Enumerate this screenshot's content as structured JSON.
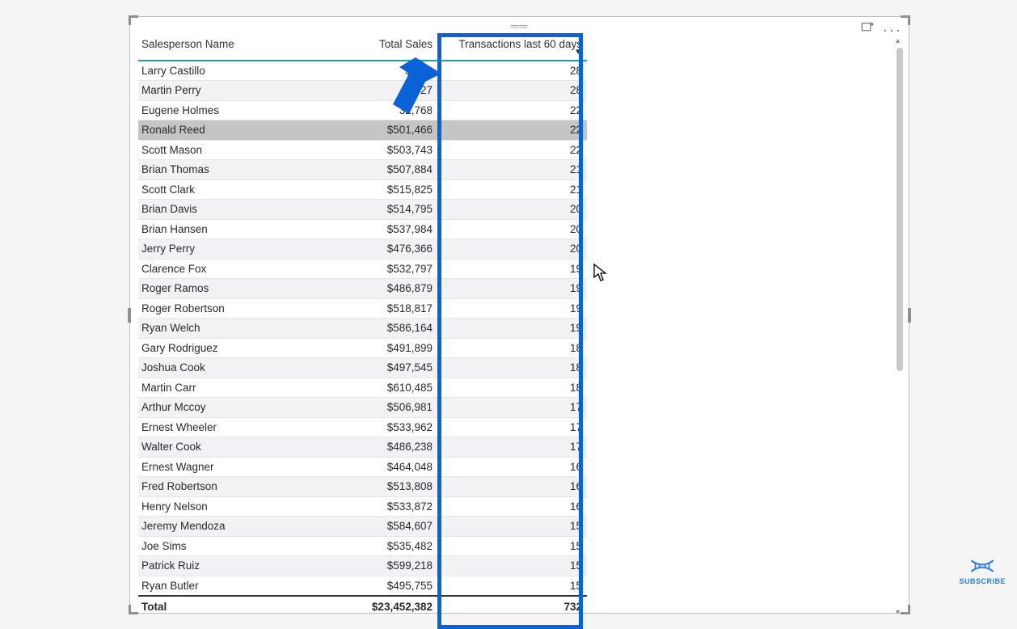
{
  "chart_data": {
    "type": "table",
    "columns": [
      "Salesperson Name",
      "Total Sales",
      "Transactions last 60 days"
    ],
    "rows": [
      [
        "Larry Castillo",
        "$483,   ",
        28
      ],
      [
        "Martin Perry",
        "$     27",
        28
      ],
      [
        "Eugene Holmes",
        "32,768",
        22
      ],
      [
        "Ronald Reed",
        "$501,466",
        22
      ],
      [
        "Scott Mason",
        "$503,743",
        22
      ],
      [
        "Brian Thomas",
        "$507,884",
        21
      ],
      [
        "Scott Clark",
        "$515,825",
        21
      ],
      [
        "Brian Davis",
        "$514,795",
        20
      ],
      [
        "Brian Hansen",
        "$537,984",
        20
      ],
      [
        "Jerry Perry",
        "$476,366",
        20
      ],
      [
        "Clarence Fox",
        "$532,797",
        19
      ],
      [
        "Roger Ramos",
        "$486,879",
        19
      ],
      [
        "Roger Robertson",
        "$518,817",
        19
      ],
      [
        "Ryan Welch",
        "$586,164",
        19
      ],
      [
        "Gary Rodriguez",
        "$491,899",
        18
      ],
      [
        "Joshua Cook",
        "$497,545",
        18
      ],
      [
        "Martin Carr",
        "$610,485",
        18
      ],
      [
        "Arthur Mccoy",
        "$506,981",
        17
      ],
      [
        "Ernest Wheeler",
        "$533,962",
        17
      ],
      [
        "Walter Cook",
        "$486,238",
        17
      ],
      [
        "Ernest Wagner",
        "$464,048",
        16
      ],
      [
        "Fred Robertson",
        "$513,808",
        16
      ],
      [
        "Henry Nelson",
        "$533,872",
        16
      ],
      [
        "Jeremy Mendoza",
        "$584,607",
        15
      ],
      [
        "Joe Sims",
        "$535,482",
        15
      ],
      [
        "Patrick Ruiz",
        "$599,218",
        15
      ],
      [
        "Ryan Butler",
        "$495,755",
        15
      ]
    ],
    "totals": [
      "Total",
      "$23,452,382",
      732
    ]
  },
  "columns": {
    "name": "Salesperson Name",
    "sales": "Total Sales",
    "tx": "Transactions last 60 days"
  },
  "totals": {
    "label": "Total",
    "sales": "$23,452,382",
    "tx": "732"
  },
  "rows": [
    {
      "name": "Larry Castillo",
      "sales": "$483,   ",
      "tx": "28",
      "selected": false
    },
    {
      "name": "Martin Perry",
      "sales": "$     27",
      "tx": "28",
      "selected": false
    },
    {
      "name": "Eugene Holmes",
      "sales": "32,768",
      "tx": "22",
      "selected": false
    },
    {
      "name": "Ronald Reed",
      "sales": "$501,466",
      "tx": "22",
      "selected": true
    },
    {
      "name": "Scott Mason",
      "sales": "$503,743",
      "tx": "22",
      "selected": false
    },
    {
      "name": "Brian Thomas",
      "sales": "$507,884",
      "tx": "21",
      "selected": false
    },
    {
      "name": "Scott Clark",
      "sales": "$515,825",
      "tx": "21",
      "selected": false
    },
    {
      "name": "Brian Davis",
      "sales": "$514,795",
      "tx": "20",
      "selected": false
    },
    {
      "name": "Brian Hansen",
      "sales": "$537,984",
      "tx": "20",
      "selected": false
    },
    {
      "name": "Jerry Perry",
      "sales": "$476,366",
      "tx": "20",
      "selected": false
    },
    {
      "name": "Clarence Fox",
      "sales": "$532,797",
      "tx": "19",
      "selected": false
    },
    {
      "name": "Roger Ramos",
      "sales": "$486,879",
      "tx": "19",
      "selected": false
    },
    {
      "name": "Roger Robertson",
      "sales": "$518,817",
      "tx": "19",
      "selected": false
    },
    {
      "name": "Ryan Welch",
      "sales": "$586,164",
      "tx": "19",
      "selected": false
    },
    {
      "name": "Gary Rodriguez",
      "sales": "$491,899",
      "tx": "18",
      "selected": false
    },
    {
      "name": "Joshua Cook",
      "sales": "$497,545",
      "tx": "18",
      "selected": false
    },
    {
      "name": "Martin Carr",
      "sales": "$610,485",
      "tx": "18",
      "selected": false
    },
    {
      "name": "Arthur Mccoy",
      "sales": "$506,981",
      "tx": "17",
      "selected": false
    },
    {
      "name": "Ernest Wheeler",
      "sales": "$533,962",
      "tx": "17",
      "selected": false
    },
    {
      "name": "Walter Cook",
      "sales": "$486,238",
      "tx": "17",
      "selected": false
    },
    {
      "name": "Ernest Wagner",
      "sales": "$464,048",
      "tx": "16",
      "selected": false
    },
    {
      "name": "Fred Robertson",
      "sales": "$513,808",
      "tx": "16",
      "selected": false
    },
    {
      "name": "Henry Nelson",
      "sales": "$533,872",
      "tx": "16",
      "selected": false
    },
    {
      "name": "Jeremy Mendoza",
      "sales": "$584,607",
      "tx": "15",
      "selected": false
    },
    {
      "name": "Joe Sims",
      "sales": "$535,482",
      "tx": "15",
      "selected": false
    },
    {
      "name": "Patrick Ruiz",
      "sales": "$599,218",
      "tx": "15",
      "selected": false
    },
    {
      "name": "Ryan Butler",
      "sales": "$495,755",
      "tx": "15",
      "selected": false
    }
  ],
  "subscribe_label": "SUBSCRIBE",
  "sort_indicator": "▼"
}
